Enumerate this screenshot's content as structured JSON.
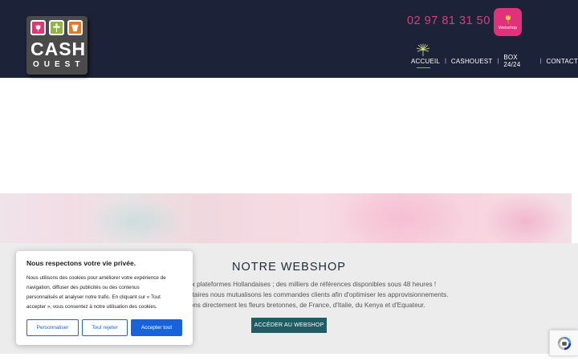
{
  "header": {
    "logo": {
      "line1": "CASH",
      "line2": "OUEST"
    },
    "phone": "02 97 81 31 50",
    "webshop_badge_label": "Webshop",
    "nav": [
      {
        "label": "ACCUEIL",
        "active": true
      },
      {
        "label": "CASHOUEST"
      },
      {
        "label": "BOX 24/24"
      },
      {
        "label": "CONTACT"
      }
    ],
    "nav_separator": "|"
  },
  "webshop_section": {
    "title": "NOTRE WEBSHOP",
    "lines": [
      "n accès direct aux plateformes Hollandaises ; des milliers de références disponibles sous 48 heures !",
      "s de ports supplémentaires nous mutualisons les commandes clients afin d'optimiser les approvisionnements.",
      "approvisionnons directement les fleurs bretonnes, de France, d'Italie, du Kenya et d'Equateur."
    ],
    "cta_label": "ACCÉDER AU WEBSHOP"
  },
  "cookie_banner": {
    "title": "Nous respectons votre vie privée.",
    "text_lines": [
      "Nous utilisons des cookies pour améliorer votre expérience de",
      "navigation, diffuser des publicités ou des contenus",
      "personnalisés et analyser notre trafic. En cliquant sur « Tout",
      "accepter », vous consentez à notre utilisation des cookies."
    ],
    "buttons": {
      "personalize": "Personnaliser",
      "reject": "Tout rejeter",
      "accept": "Accepter tout"
    }
  },
  "colors": {
    "header_bg": "#1c2237",
    "accent_pink": "#e0327a",
    "cta_teal": "#1f5c63",
    "cookie_blue": "#1863dc",
    "nav_active_underline": "#7ac143"
  },
  "icons": [
    "tulip-icon",
    "sprout-icon",
    "flowerpot-icon",
    "flower-badge-icon",
    "dandelion-icon",
    "recaptcha-icon"
  ]
}
